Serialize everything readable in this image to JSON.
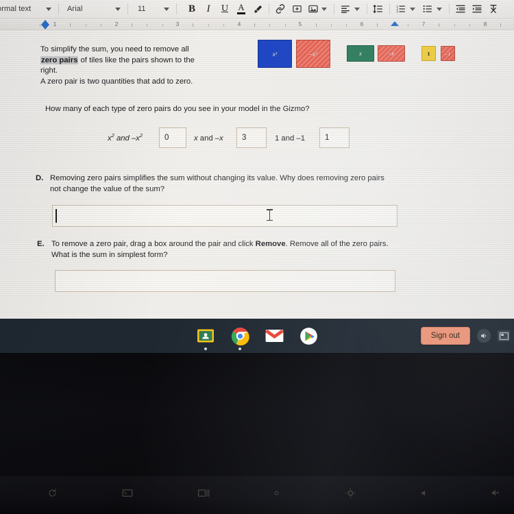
{
  "app": {
    "name": "Google Docs",
    "platform": "Chromebook"
  },
  "toolbar": {
    "style_label": "Normal text",
    "font_label": "Arial",
    "font_size_label": "11",
    "buttons": [
      {
        "name": "bold-button",
        "label": "B"
      },
      {
        "name": "italic-button",
        "label": "I"
      },
      {
        "name": "underline-button",
        "label": "U"
      },
      {
        "name": "text-color-button",
        "label": "A"
      },
      {
        "name": "highlight-color-button",
        "label": "highlight-pen-icon"
      },
      {
        "name": "insert-link-button",
        "label": "link-icon"
      },
      {
        "name": "add-comment-button",
        "label": "comment-icon"
      },
      {
        "name": "insert-image-button",
        "label": "image-icon"
      },
      {
        "name": "align-button",
        "label": "align-left-icon"
      },
      {
        "name": "line-spacing-button",
        "label": "line-spacing-icon"
      },
      {
        "name": "numbered-list-button",
        "label": "numbered-list-icon"
      },
      {
        "name": "bulleted-list-button",
        "label": "bulleted-list-icon"
      },
      {
        "name": "decrease-indent-button",
        "label": "decrease-indent-icon"
      },
      {
        "name": "increase-indent-button",
        "label": "increase-indent-icon"
      },
      {
        "name": "clear-formatting-button",
        "label": "clear-formatting-icon"
      }
    ]
  },
  "ruler": {
    "numbers": [
      "1",
      "2",
      "3",
      "4",
      "5",
      "6",
      "7",
      "8"
    ]
  },
  "document": {
    "intro": {
      "line1": "To simplify the sum, you need to remove all",
      "highlight": "zero pairs",
      "line2_rest": " of tiles like the pairs shown to the",
      "line3": "right.",
      "line4": "A zero pair is two quantities that add to zero."
    },
    "question": "How many of each type of zero pairs do you see in your model in the Gizmo?",
    "answers": [
      {
        "label_html": "x² and –x²",
        "value": "0"
      },
      {
        "label_html": "x and –x",
        "value": "3"
      },
      {
        "label_html": "1 and –1",
        "value": "1"
      }
    ],
    "sections": [
      {
        "letter": "D.",
        "line1": "Removing zero pairs simplifies the sum without changing its value. Why does removing zero pairs",
        "line2": "not change the value of the sum?",
        "answer_value": ""
      },
      {
        "letter": "E.",
        "line1_a": "To remove a zero pair, drag a box around the pair and click ",
        "line1_bold": "Remove",
        "line1_b": ". Remove all of the zero pairs.",
        "line2": "What is the sum in simplest form?",
        "answer_value": ""
      }
    ],
    "tiles": [
      {
        "name": "tile-x-squared",
        "label": "x²",
        "color": "#1c44c4",
        "kind": "xsq"
      },
      {
        "name": "tile-neg-x-squared",
        "label": "–x²",
        "color": "#e8604f",
        "kind": "neg"
      },
      {
        "name": "tile-x",
        "label": "x",
        "color": "#2c7c5b",
        "kind": "xr"
      },
      {
        "name": "tile-neg-x",
        "label": "–x",
        "color": "#e8604f",
        "kind": "neg"
      },
      {
        "name": "tile-one",
        "label": "1",
        "color": "#f2cf3e",
        "kind": "one"
      },
      {
        "name": "tile-neg-one",
        "label": "–1",
        "color": "#e8604f",
        "kind": "neg"
      }
    ]
  },
  "shelf": {
    "apps": [
      {
        "name": "google-classroom-icon",
        "title": "Classroom"
      },
      {
        "name": "google-chrome-icon",
        "title": "Chrome"
      },
      {
        "name": "gmail-icon",
        "title": "Gmail"
      },
      {
        "name": "google-play-store-icon",
        "title": "Play Store"
      }
    ],
    "sign_out_label": "Sign out",
    "tray": [
      {
        "name": "volume-icon"
      },
      {
        "name": "status-tray-icon"
      }
    ]
  },
  "keyboard": {
    "function_keys": [
      {
        "name": "refresh-key"
      },
      {
        "name": "fullscreen-key"
      },
      {
        "name": "overview-key"
      },
      {
        "name": "brightness-down-key"
      },
      {
        "name": "brightness-up-key"
      },
      {
        "name": "volume-down-key"
      },
      {
        "name": "volume-mute-key"
      }
    ]
  },
  "colors": {
    "shelf_bg": "#1f2730",
    "signout_bg": "#ef9678",
    "page_bg": "#f2f0ec",
    "highlight": "#c9c9c9"
  }
}
